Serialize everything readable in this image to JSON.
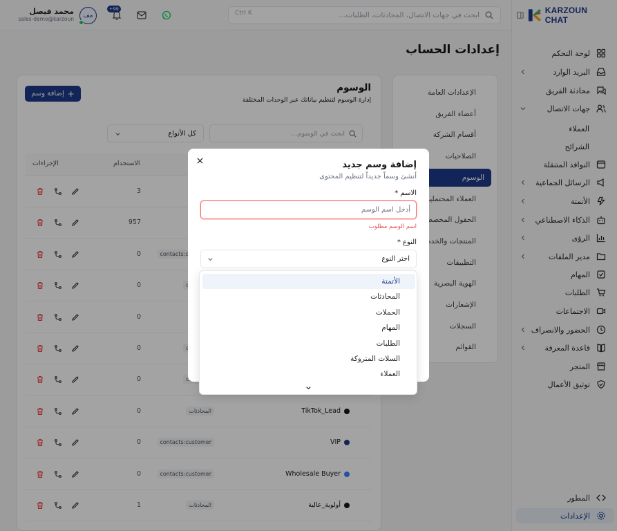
{
  "brand": {
    "logo_text": "KARZOUN CHAT"
  },
  "header": {
    "user_name": "محمد فيصل",
    "user_email": "sales-demo@karzoun",
    "avatar_initials": "مف",
    "notification_count": "+99",
    "search_placeholder": "ابحث في جهات الاتصال، المحادثات، الطلبات...",
    "search_shortcut": "Ctrl K"
  },
  "sidebar": {
    "items": [
      {
        "label": "لوحة التحكم",
        "icon": "dashboard-icon"
      },
      {
        "label": "البريد الوارد",
        "icon": "inbox-icon",
        "chevron": true
      },
      {
        "label": "محادثة الفريق",
        "icon": "team-chat-icon"
      },
      {
        "label": "جهات الاتصال",
        "icon": "contacts-icon",
        "chevron": true
      }
    ],
    "sub_items": [
      "العملاء",
      "الشرائح"
    ],
    "items2": [
      {
        "label": "النوافذ المتنقلة",
        "icon": "window-icon"
      },
      {
        "label": "الرسائل الجماعية",
        "icon": "broadcast-icon",
        "chevron": true
      },
      {
        "label": "الأتمتة",
        "icon": "automation-icon",
        "chevron": true
      },
      {
        "label": "الذكاء الاصطناعي",
        "icon": "robot-icon",
        "chevron": true
      },
      {
        "label": "الرؤى",
        "icon": "chart-icon",
        "chevron": true
      },
      {
        "label": "مدير الملفات",
        "icon": "folder-icon",
        "chevron": true
      },
      {
        "label": "المهام",
        "icon": "tasks-icon"
      },
      {
        "label": "الطلبات",
        "icon": "cart-icon"
      },
      {
        "label": "الاجتماعات",
        "icon": "video-icon"
      },
      {
        "label": "الحضور والانصراف",
        "icon": "clock-icon",
        "chevron": true
      },
      {
        "label": "قاعدة المعرفة",
        "icon": "book-icon",
        "chevron": true
      },
      {
        "label": "المتجر",
        "icon": "store-icon"
      },
      {
        "label": "توثيق الأعمال",
        "icon": "shield-check-icon"
      }
    ],
    "bottom": [
      {
        "label": "المطور",
        "icon": "code-icon"
      },
      {
        "label": "الإعدادات",
        "icon": "gear-icon"
      }
    ]
  },
  "page": {
    "title": "إعدادات الحساب"
  },
  "settings_nav": [
    "الإعدادات العامة",
    "أعضاء الفريق",
    "أقسام الشركة",
    "الصلاحيات",
    "الوسوم",
    "العملاء المحتملين",
    "الحقول المخصصة",
    "المنتجات والخدمات",
    "التطبيقات",
    "الهوية البصرية",
    "الإشعارات",
    "السجلات",
    "القوائم"
  ],
  "tags": {
    "title": "الوسوم",
    "subtitle": "إدارة الوسوم لتنظيم بياناتك عبر الوحدات المختلفة",
    "add_button": "إضافة وسم",
    "search_placeholder": "ابحث في الوسوم...",
    "type_filter": "كل الأنواع",
    "columns": {
      "usage": "الاستخدام",
      "actions": "الإجراءات"
    },
    "rows": [
      {
        "name": "",
        "type": "",
        "usage": "3",
        "color": "#3b82f6"
      },
      {
        "name": "",
        "type": "",
        "usage": "957",
        "color": "#3b82f6"
      },
      {
        "name": "",
        "type": "contacts:customer",
        "usage": "0",
        "color": "#3b82f6"
      },
      {
        "name": "",
        "type": "contacts:",
        "usage": "0",
        "color": "#3b82f6"
      },
      {
        "name": "",
        "type": "",
        "usage": "0",
        "color": "#3b82f6"
      },
      {
        "name": "",
        "type": "contacts:",
        "usage": "0",
        "color": "#3b82f6"
      },
      {
        "name": "",
        "type": "contacts:",
        "usage": "0",
        "color": "#3b82f6"
      },
      {
        "name": "TikTok_Lead",
        "type": "المحادثات",
        "usage": "0",
        "color": "#18181b"
      },
      {
        "name": "VIP",
        "type": "contacts:customer",
        "usage": "0",
        "color": "#1e3a8a"
      },
      {
        "name": "Wholesale Buyer",
        "type": "contacts:customer",
        "usage": "0",
        "color": "#3b82f6"
      },
      {
        "name": "أولوية_عالية",
        "type": "المحادثات",
        "usage": "1",
        "color": "#18181b"
      }
    ]
  },
  "modal": {
    "title": "إضافة وسم جديد",
    "subtitle": "أنشئ وسماً جديداً لتنظيم المحتوى",
    "name_label": "الاسم *",
    "name_placeholder": "أدخل اسم الوسم",
    "name_error": "اسم الوسم مطلوب",
    "type_label": "النوع *",
    "type_placeholder": "اختر النوع",
    "options": [
      "الأتمتة",
      "المحادثات",
      "الحملات",
      "المهام",
      "الطلبات",
      "السلات المتروكة",
      "العملاء"
    ]
  },
  "colors": {
    "primary": "#1e3a8a",
    "error": "#ef4444",
    "whatsapp": "#25d366"
  }
}
